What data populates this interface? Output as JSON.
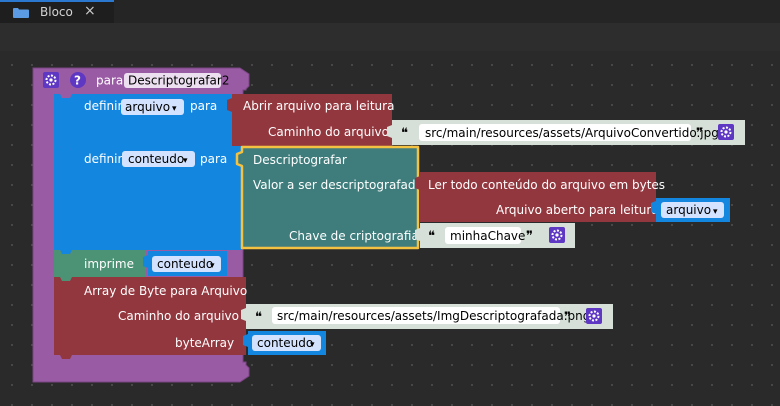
{
  "tab": {
    "title": "Bloco",
    "close": "×",
    "icon": "folder-icon"
  },
  "procedure": {
    "label": "para",
    "name": "Descriptografar2",
    "icons": [
      "gear-icon",
      "help-icon"
    ]
  },
  "set_arquivo": {
    "label": "definir",
    "variable": "arquivo",
    "to": "para",
    "call": "Abrir arquivo para leitura",
    "param_label": "Caminho do arquivo",
    "value": "src/main/resources/assets/ArquivoConvertido.jpg"
  },
  "set_conteudo": {
    "label": "definir",
    "variable": "conteudo",
    "to": "para",
    "call": "Descriptografar",
    "param1_label": "Valor a ser descriptografado",
    "inner_call": "Ler todo conteúdo do arquivo em bytes",
    "inner_param_label": "Arquivo aberto para leitura",
    "inner_value": "arquivo",
    "param2_label": "Chave de criptografia",
    "key_value": "minhaChave"
  },
  "print_block": {
    "label": "imprime",
    "variable": "conteudo"
  },
  "byte_array": {
    "label": "Array de Byte para Arquivo",
    "param1_label": "Caminho do arquivo",
    "value": "src/main/resources/assets/ImgDescriptografada.png",
    "param2_label": "byteArray",
    "variable": "conteudo"
  },
  "glyphs": {
    "open_quote": "❝",
    "close_quote": "❞",
    "dropdown": "▾"
  },
  "colors": {
    "procedure": "#9a5ba5",
    "variable_set": "#1386e0",
    "function_call": "#93373e",
    "text": "#d6e0d8",
    "decrypt": "#3e7d7c",
    "print": "#4c9274",
    "selection": "#f3c243",
    "pill": "#d3e3ff"
  }
}
